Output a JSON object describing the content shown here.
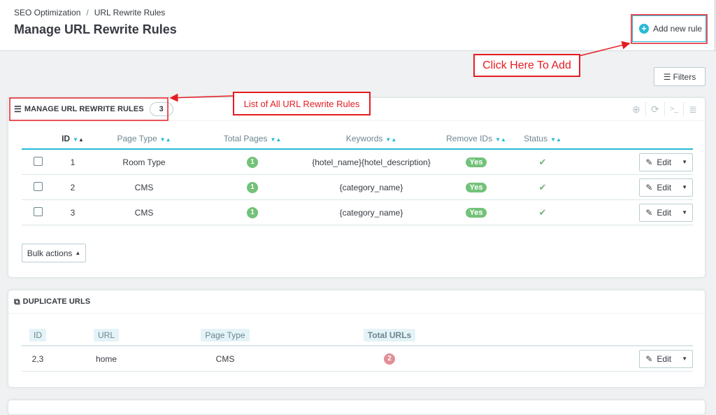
{
  "breadcrumb": {
    "parent": "SEO Optimization",
    "separator": "/",
    "current": "URL Rewrite Rules"
  },
  "page_title": "Manage URL Rewrite Rules",
  "toolbar": {
    "add_label": "Add new rule",
    "filters_label": "Filters"
  },
  "panel_rules": {
    "title": "Manage URL Rewrite Rules",
    "count": "3",
    "columns": [
      "ID",
      "Page Type",
      "Total Pages",
      "Keywords",
      "Remove IDs",
      "Status"
    ],
    "rows": [
      {
        "id": "1",
        "page_type": "Room Type",
        "total_pages": "1",
        "keywords": "{hotel_name}{hotel_description}",
        "remove_ids": "Yes",
        "edit": "Edit"
      },
      {
        "id": "2",
        "page_type": "CMS",
        "total_pages": "1",
        "keywords": "{category_name}",
        "remove_ids": "Yes",
        "edit": "Edit"
      },
      {
        "id": "3",
        "page_type": "CMS",
        "total_pages": "1",
        "keywords": "{category_name}",
        "remove_ids": "Yes",
        "edit": "Edit"
      }
    ],
    "bulk_label": "Bulk actions"
  },
  "panel_duplicates": {
    "title": "Duplicate URLs",
    "columns": [
      "ID",
      "URL",
      "Page Type",
      "Total URLs"
    ],
    "rows": [
      {
        "id": "2,3",
        "url": "home",
        "page_type": "CMS",
        "total_urls": "2",
        "edit": "Edit"
      }
    ]
  },
  "annotations": {
    "add": "Click Here To Add",
    "list": "List of All URL Rewrite Rules"
  },
  "colors": {
    "accent": "#25b9d7",
    "success": "#72c279",
    "danger": "#e08f95",
    "annotation": "#e51c23"
  }
}
